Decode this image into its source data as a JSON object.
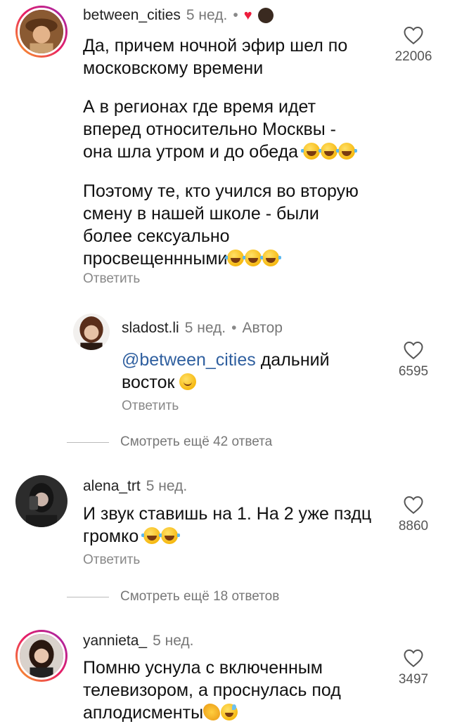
{
  "comments": [
    {
      "username": "between_cities",
      "time": "5 нед.",
      "dot": "•",
      "body_1": "Да, причем ночной эфир шел по\nмосковскому времени",
      "body_2": "А в регионах где время идет\nвперед относительно Москвы -\nона шла утром и до обеда ",
      "body_3": "Поэтому те, кто учился во вторую\nсмену в нашей школе - были\nболее сексуально\nпросвещеннными",
      "reply_label": "Ответить",
      "likes": "22006"
    },
    {
      "username": "sladost.li",
      "time": "5 нед.",
      "dot": "•",
      "author_label": "Автор",
      "mention": "@between_cities",
      "body": " дальний\nвосток ",
      "reply_label": "Ответить",
      "likes": "6595"
    },
    {
      "username": "alena_trt",
      "time": "5 нед.",
      "body": "И звук ставишь на 1. На 2 уже пздц\nгромко ",
      "reply_label": "Ответить",
      "likes": "8860"
    },
    {
      "username": "yannieta_",
      "time": "5 нед.",
      "body": "Помню уснула с включенным\nтелевизором, а проснулась под\nаплодисменты",
      "likes": "3497"
    }
  ],
  "view_more": [
    "Смотреть ещё 42 ответа",
    "Смотреть ещё 18 ответов"
  ],
  "colors": {
    "mention": "#2f5f9f",
    "heart": "#ed1c3c",
    "muted": "#888888"
  },
  "icons": {
    "like": "heart-outline-icon",
    "creator_liked": "heart-filled-icon"
  }
}
